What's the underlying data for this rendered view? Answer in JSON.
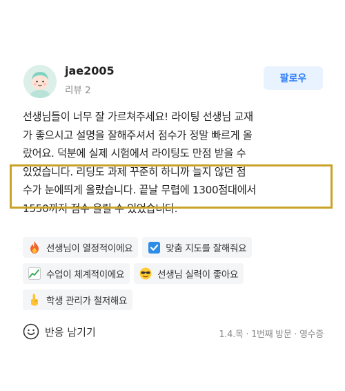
{
  "user": {
    "name": "jae2005",
    "review_count": "리뷰 2"
  },
  "follow_label": "팔로우",
  "review": {
    "lines": [
      "선생님들이 너무 잘 가르쳐주세요! 라이팅 선생님 교재",
      "가 좋으시고 설명을 잘해주셔서 점수가 정말 빠르게 올",
      "랐어요. 덕분에 실제 시험에서 라이팅도 만점 받을 수",
      "있었습니다. 리딩도 과제 꾸준히 하니까 늘지 않던 점",
      "수가 눈에띄게 올랐습니다. 끝날 무렵에 1300점대에서",
      "1550까지 점수 올릴 수 있었습니다."
    ]
  },
  "tags": [
    {
      "icon": "fire-icon",
      "label": "선생님이 열정적이에요"
    },
    {
      "icon": "check-box-icon",
      "label": "맞춤 지도를 잘해줘요"
    },
    {
      "icon": "chart-up-icon",
      "label": "수업이 체계적이에요"
    },
    {
      "icon": "sunglasses-face-icon",
      "label": "선생님 실력이 좋아요"
    },
    {
      "icon": "pointing-up-icon",
      "label": "학생 관리가 철저해요"
    }
  ],
  "footer": {
    "react_label": "반응 남기기",
    "meta": "1.4.목 · 1번째 방문 · 영수증"
  },
  "colors": {
    "follow_bg": "#e9f3ff",
    "follow_text": "#2d7df6",
    "highlight_border": "#c9a227",
    "tag_bg": "#f4f5f7"
  }
}
